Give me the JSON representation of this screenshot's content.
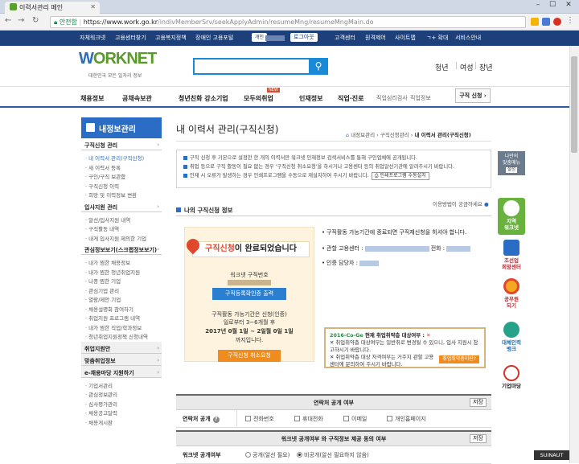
{
  "browser": {
    "tab_title": "이력서관리 메인",
    "secure_label": "안전함",
    "url_host": "https://www.work.go.kr",
    "url_path": "/indivMemberSrv/seekApplyAdmin/resumeMng/resumeMngMain.do"
  },
  "utility": {
    "items": [
      "자체워크넷",
      "고용센터찾기",
      "고용복지정책",
      "장애인 고용포털"
    ],
    "user_badge": "개인",
    "logout": "로그아웃",
    "right_items": [
      "고객센터",
      "원격제어",
      "사이트맵",
      "ㄱ+ 확대",
      "서비스안내"
    ]
  },
  "header": {
    "logo_w": "W",
    "logo_rest": "ORKNET",
    "logo_sub": "대한민국 모든 일자리 정보",
    "search_icon": "search-icon",
    "personas": [
      "청년",
      "여성",
      "장년"
    ]
  },
  "gnb": {
    "items": [
      "채용정보",
      "공채속보관",
      "청년친화 강소기업",
      "모두의취업",
      "인재정보",
      "직업·진로"
    ],
    "new_badge": "NEW",
    "sub1": "직업심리검사",
    "sub2": "직업정보",
    "apply_button": "구직 신청 ›"
  },
  "lnb": {
    "title": "내정보관리",
    "sections": [
      {
        "label": "구직신청 관리",
        "items": [
          "· 내 이력서 관리(구직신청)",
          "· 새 이력서 등록",
          "· 구인/구직 보관함",
          "· 구직신청 이력",
          "· 희망 및 이력정보 변환"
        ]
      },
      {
        "label": "입사지원 관리",
        "items": [
          "· 알선/입사지원 내역",
          "· 구직활동 내역",
          "· 내게 입사지원 제의한 기업"
        ]
      },
      {
        "label": "관심정보보기(스크랩정보보기)",
        "items": [
          "· 내가 찜한 채용정보",
          "· 내가 찜한 청년취업지원",
          "· 나중 찜한 기업",
          "· 관심기업 관리",
          "· 열람/제안 기업",
          "· 채용설명회 참여하기",
          "· 취업지원 프로그램 내역",
          "· 내가 찜한 직업/학과정보",
          "· 청년취업지원정책 신청내역"
        ]
      }
    ],
    "gray_sections": [
      "취업지원안",
      "맞춤취업정보",
      "e-채용마당 지원하기"
    ],
    "bottom_items": [
      "· 기업서관리",
      "· 관심정보관리",
      "· 심사평가관리",
      "· 채용공고달력",
      "· 채용게시판"
    ]
  },
  "main": {
    "page_title": "내 이력서 관리(구직신청)",
    "breadcrumb": "내정보관리 › 구직신청관리 ›",
    "breadcrumb_current": "내 이력서 관리(구직신청)",
    "notices": [
      "구직 신청 후 기본으로 설정한 한 개의 이력서만 워크넷 인재정보 검색서비스를 통해 구인업체에 공개됩니다.",
      "취업 등으로 구직 활동이 필요 없는 경우 '구직신청 취소요청'을 하시거나 고용센터 등의 취업알선기관에 알려주시기 바랍니다.",
      "인재 시 오류가 발생하는 경우 인쇄프로그램을 수동으로 재설치하여 주시기 바랍니다."
    ],
    "notice_button": "인쇄프로그램 수동설치",
    "faq": "이용방법이 궁금하세요",
    "status_heading": "나의 구직신청 정보",
    "done_part1": "구직신청",
    "done_part2": "이 완료되었습니다",
    "worknet_no_label": "워크넷 구직번호",
    "print_button": "구직등록확인증 출력",
    "period_line1": "구직활동 가능기간은 신청(인증)",
    "period_line2": "일로부터 3~6개월 후",
    "period_line3": "2017년 0월 1일 ~ 2일월 0일 1일",
    "period_line4": "까지입니다.",
    "cancel_button": "구직신청 취소요청",
    "info": [
      "구직활동 가능기간에 종료되면 구직재신청을 하셔야 합니다.",
      "관할 고용센터 :",
      "인증 담당자 :"
    ],
    "info_phone_label": "전화 :",
    "covid_year": "2016-Co-Ge",
    "covid_title": "현재 취업취약층 대상여부 :",
    "covid_x": "✕",
    "covid_lines": [
      "✕ 취업취약층 대상여부는 일반취로 변경될 수 있으니, 입사 지원시 참고하시기 바랍니다.",
      "✕ 취업취약층 대상 자격여부는 거주지 관할 고용센터에 문의하여 주시기 바랍니다."
    ],
    "covid_link": "취업취약층이란?",
    "table1_head": "연락처 공개 여부",
    "save": "저장",
    "row1_label": "연락처 공개",
    "row1_opts": [
      "전화번호",
      "휴대전화",
      "이메일",
      "개인홈페이지"
    ],
    "table2_head": "워크넷 공개여부 와 구직정보 제공 동의 여부",
    "row2_label": "워크넷 공개여부",
    "row2_opts": [
      "공개(알선 필요)",
      "비공개(알선 필요하지 않음)"
    ]
  },
  "quick": {
    "top_line1": "나만의",
    "top_line2": "맞춤메뉴",
    "toggle": "설정",
    "items": [
      {
        "l1": "지역",
        "l2": "워크넷"
      },
      {
        "l1": "조선업",
        "l2": "희망센터"
      },
      {
        "l1": "공무원",
        "l2": "되기"
      },
      {
        "l1": "대체인력",
        "l2": "뱅크"
      },
      {
        "l1": "기업마당",
        "l2": ""
      }
    ]
  },
  "watermark": "SUINAUT",
  "colors": {
    "brand_blue": "#2b6cc4",
    "navy": "#1d3f7a",
    "accent_orange": "#f08c1e",
    "alert_red": "#e0472b"
  }
}
